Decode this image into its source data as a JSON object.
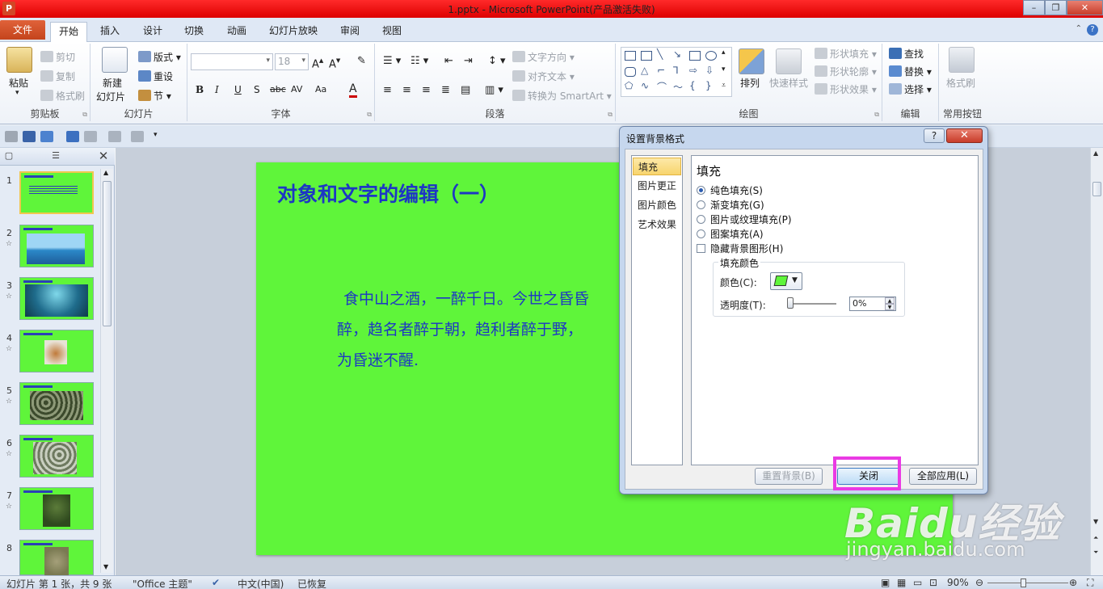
{
  "window": {
    "title": "1.pptx - Microsoft PowerPoint(产品激活失败)",
    "app_icon": "P"
  },
  "tabs": [
    "文件",
    "开始",
    "插入",
    "设计",
    "切换",
    "动画",
    "幻灯片放映",
    "审阅",
    "视图"
  ],
  "ribbon": {
    "clipboard": {
      "label": "剪贴板",
      "paste": "粘贴",
      "cut": "剪切",
      "copy": "复制",
      "format_painter": "格式刷"
    },
    "slides": {
      "label": "幻灯片",
      "new_slide_1": "新建",
      "new_slide_2": "幻灯片",
      "layout": "版式",
      "reset": "重设",
      "section": "节"
    },
    "font": {
      "label": "字体",
      "font_size": "18",
      "format_buttons": [
        "B",
        "I",
        "U",
        "S",
        "abc",
        "AV",
        "Aa",
        "A"
      ]
    },
    "paragraph": {
      "label": "段落",
      "text_direction": "文字方向",
      "align_text": "对齐文本",
      "smartart": "转换为 SmartArt"
    },
    "drawing": {
      "label": "绘图",
      "arrange": "排列",
      "quick_styles": "快速样式",
      "shape_fill": "形状填充",
      "shape_outline": "形状轮廓",
      "shape_effects": "形状效果"
    },
    "editing": {
      "label": "编辑",
      "find": "查找",
      "replace": "替换",
      "select": "选择"
    },
    "common": {
      "label": "常用按钮",
      "format_painter": "格式刷"
    }
  },
  "thumbnails": [
    {
      "num": "1",
      "selected": true,
      "star": false
    },
    {
      "num": "2",
      "selected": false,
      "star": true
    },
    {
      "num": "3",
      "selected": false,
      "star": true
    },
    {
      "num": "4",
      "selected": false,
      "star": true
    },
    {
      "num": "5",
      "selected": false,
      "star": true
    },
    {
      "num": "6",
      "selected": false,
      "star": true
    },
    {
      "num": "7",
      "selected": false,
      "star": true
    },
    {
      "num": "8",
      "selected": false,
      "star": false
    }
  ],
  "thumb_close": "✕",
  "slide": {
    "background": "#5ff53a",
    "text_color": "#1d37c4",
    "title": "对象和文字的编辑（一）",
    "body_lines": [
      "食中山之酒，一醉千日。今世之昏昏",
      "醉，趋名者醉于朝，趋利者醉于野，",
      "为昏迷不醒."
    ]
  },
  "dialog": {
    "title": "设置背景格式",
    "help": "?",
    "close_glyph": "✕",
    "nav": [
      "填充",
      "图片更正",
      "图片颜色",
      "艺术效果"
    ],
    "section_title": "填充",
    "options": [
      {
        "label": "纯色填充(S)",
        "type": "radio",
        "checked": true
      },
      {
        "label": "渐变填充(G)",
        "type": "radio",
        "checked": false
      },
      {
        "label": "图片或纹理填充(P)",
        "type": "radio",
        "checked": false
      },
      {
        "label": "图案填充(A)",
        "type": "radio",
        "checked": false
      },
      {
        "label": "隐藏背景图形(H)",
        "type": "checkbox",
        "checked": false
      }
    ],
    "fill_color_group": "填充颜色",
    "color_label": "颜色(C):",
    "transparency_label": "透明度(T):",
    "transparency_value": "0%",
    "reset_button": "重置背景(B)",
    "close_button": "关闭",
    "apply_all_button": "全部应用(L)",
    "highlight_color": "#ea3ae4"
  },
  "statusbar": {
    "slide_info": "幻灯片 第 1 张，共 9 张",
    "theme": "\"Office 主题\"",
    "language": "中文(中国)",
    "restored": "已恢复",
    "zoom": "90%"
  },
  "watermark": {
    "brand": "Baidu经验",
    "url": "jingyan.baidu.com"
  }
}
